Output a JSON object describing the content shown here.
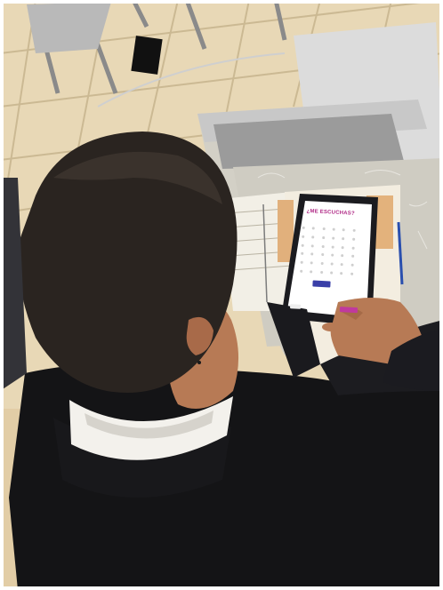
{
  "photo": {
    "tablet_screen": {
      "title": "¿ME ESCUCHAS?",
      "accent_color": "#c0399e",
      "button_color": "#3a3fa8"
    },
    "colors": {
      "floor_tile": "#e9d9b8",
      "hoodie": "#141416",
      "hair": "#2a2420",
      "skin": "#b77a55",
      "tablet": "#1b1b1f",
      "desk": "#d6d2c8"
    }
  }
}
